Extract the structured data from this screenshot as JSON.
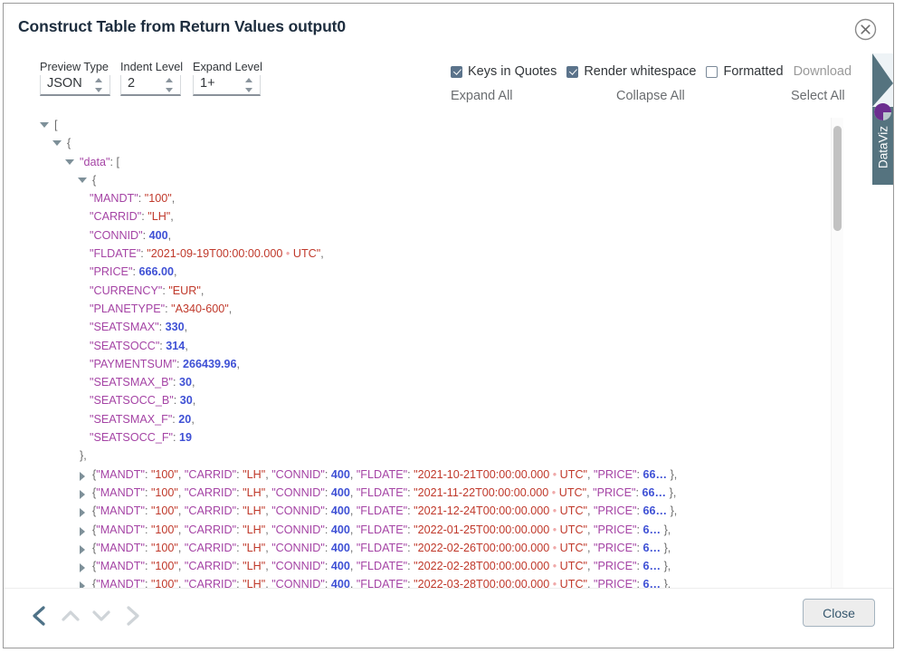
{
  "dialog": {
    "title": "Construct Table from Return Values output0",
    "close_icon": "close-circle-icon"
  },
  "toolbar": {
    "fields": [
      {
        "label": "Preview Type",
        "value": "JSON"
      },
      {
        "label": "Indent Level",
        "value": "2"
      },
      {
        "label": "Expand Level",
        "value": "1+"
      }
    ],
    "checkboxes": [
      {
        "label": "Keys in Quotes",
        "checked": true
      },
      {
        "label": "Render whitespace",
        "checked": true
      },
      {
        "label": "Formatted",
        "checked": false
      }
    ],
    "download_label": "Download",
    "expand_all_label": "Expand All",
    "collapse_all_label": "Collapse All",
    "select_all_label": "Select All"
  },
  "json_tree": {
    "root_open_bracket": "[",
    "object_open_brace": "{",
    "data_key": "\"data\"",
    "data_open_bracket": "[",
    "item_open_brace": "{",
    "item_close_brace": "},",
    "fields": [
      {
        "key": "\"MANDT\"",
        "value": "\"100\"",
        "type": "string",
        "comma": ","
      },
      {
        "key": "\"CARRID\"",
        "value": "\"LH\"",
        "type": "string",
        "comma": ","
      },
      {
        "key": "\"CONNID\"",
        "value": "400",
        "type": "number",
        "comma": ","
      },
      {
        "key": "\"FLDATE\"",
        "value_pre": "\"2021-09-19T00:00:00.000",
        "value_post": "UTC\"",
        "type": "date",
        "comma": ","
      },
      {
        "key": "\"PRICE\"",
        "value": "666.00",
        "type": "number",
        "comma": ","
      },
      {
        "key": "\"CURRENCY\"",
        "value": "\"EUR\"",
        "type": "string",
        "comma": ","
      },
      {
        "key": "\"PLANETYPE\"",
        "value": "\"A340-600\"",
        "type": "string",
        "comma": ","
      },
      {
        "key": "\"SEATSMAX\"",
        "value": "330",
        "type": "number",
        "comma": ","
      },
      {
        "key": "\"SEATSOCC\"",
        "value": "314",
        "type": "number",
        "comma": ","
      },
      {
        "key": "\"PAYMENTSUM\"",
        "value": "266439.96",
        "type": "number",
        "comma": ","
      },
      {
        "key": "\"SEATSMAX_B\"",
        "value": "30",
        "type": "number",
        "comma": ","
      },
      {
        "key": "\"SEATSOCC_B\"",
        "value": "30",
        "type": "number",
        "comma": ","
      },
      {
        "key": "\"SEATSMAX_F\"",
        "value": "20",
        "type": "number",
        "comma": ","
      },
      {
        "key": "\"SEATSOCC_F\"",
        "value": "19",
        "type": "number",
        "comma": ""
      }
    ],
    "collapsed_rows": [
      {
        "mandt": "\"100\"",
        "carrid": "\"LH\"",
        "connid": "400",
        "fldate_pre": "\"2021-10-21T00:00:00.000",
        "fldate_post": "UTC\"",
        "price": "66"
      },
      {
        "mandt": "\"100\"",
        "carrid": "\"LH\"",
        "connid": "400",
        "fldate_pre": "\"2021-11-22T00:00:00.000",
        "fldate_post": "UTC\"",
        "price": "66"
      },
      {
        "mandt": "\"100\"",
        "carrid": "\"LH\"",
        "connid": "400",
        "fldate_pre": "\"2021-12-24T00:00:00.000",
        "fldate_post": "UTC\"",
        "price": "66"
      },
      {
        "mandt": "\"100\"",
        "carrid": "\"LH\"",
        "connid": "400",
        "fldate_pre": "\"2022-01-25T00:00:00.000",
        "fldate_post": "UTC\"",
        "price": "6"
      },
      {
        "mandt": "\"100\"",
        "carrid": "\"LH\"",
        "connid": "400",
        "fldate_pre": "\"2022-02-26T00:00:00.000",
        "fldate_post": "UTC\"",
        "price": "6"
      },
      {
        "mandt": "\"100\"",
        "carrid": "\"LH\"",
        "connid": "400",
        "fldate_pre": "\"2022-02-28T00:00:00.000",
        "fldate_post": "UTC\"",
        "price": "6"
      },
      {
        "mandt": "\"100\"",
        "carrid": "\"LH\"",
        "connid": "400",
        "fldate_pre": "\"2022-03-28T00:00:00.000",
        "fldate_post": "UTC\"",
        "price": "6"
      }
    ],
    "collapsed_keys": {
      "mandt": "\"MANDT\"",
      "carrid": "\"CARRID\"",
      "connid": "\"CONNID\"",
      "fldate": "\"FLDATE\"",
      "price": "\"PRICE\""
    },
    "ellipsis": "…",
    "row_close": "},"
  },
  "side_tab": {
    "label": "DataViz"
  },
  "footer": {
    "nav": [
      {
        "icon": "chevron-left-icon",
        "state": "active"
      },
      {
        "icon": "chevron-up-icon",
        "state": "disabled"
      },
      {
        "icon": "chevron-down-icon",
        "state": "disabled"
      },
      {
        "icon": "chevron-right-icon",
        "state": "disabled"
      }
    ],
    "close_label": "Close"
  },
  "colors": {
    "key": "#a544a5",
    "string": "#c0392b",
    "number": "#3f51d5",
    "whitespace_dot": "#f0a9a9",
    "accent": "#55737f",
    "button_text": "#36576e"
  }
}
